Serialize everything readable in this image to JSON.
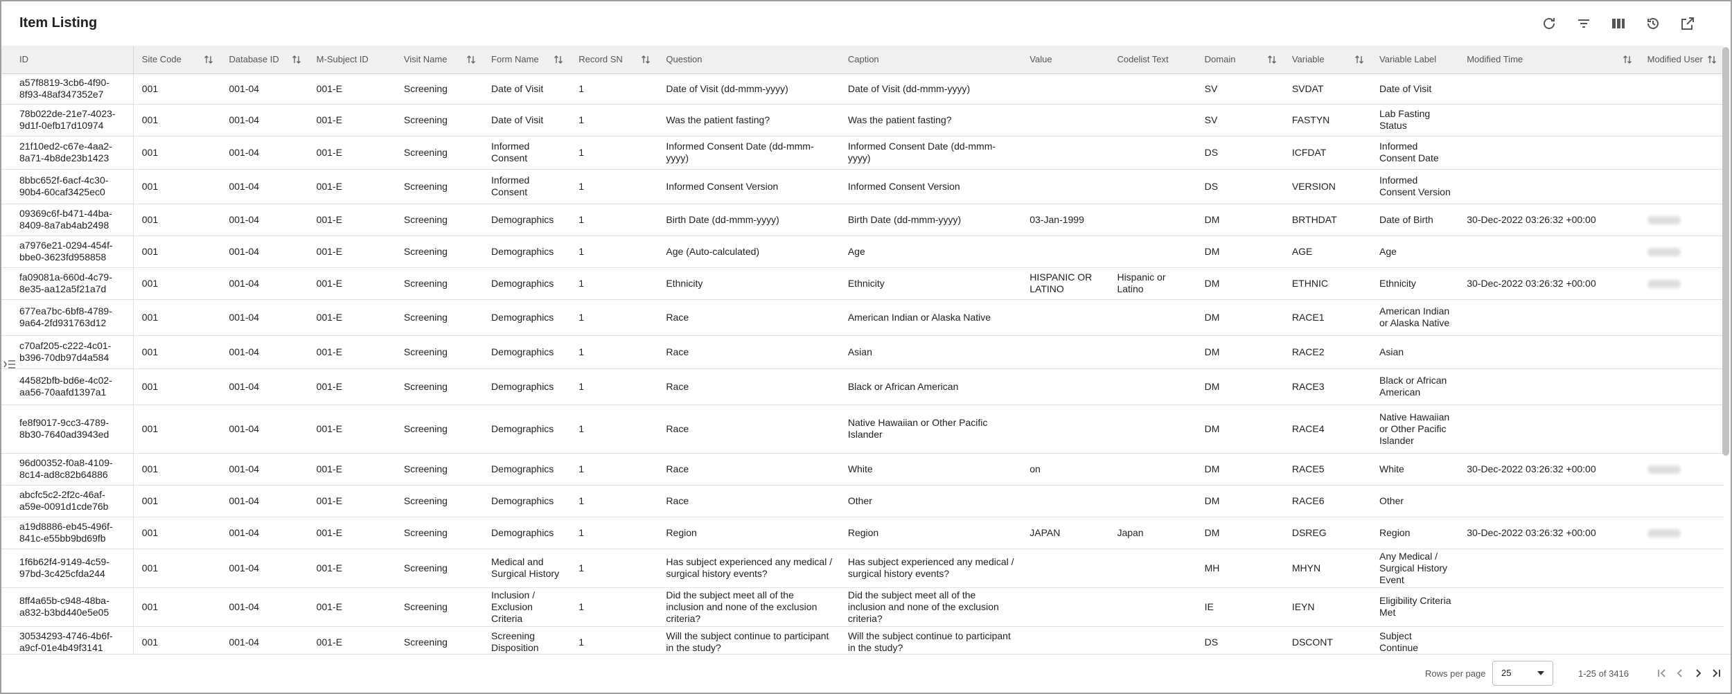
{
  "page": {
    "title": "Item Listing"
  },
  "toolbar": {
    "icons": [
      "refresh-icon",
      "filter-icon",
      "columns-icon",
      "history-icon",
      "open-external-icon"
    ]
  },
  "table": {
    "columns": [
      "ID",
      "Site Code",
      "Database ID",
      "M-Subject ID",
      "Visit Name",
      "Form Name",
      "Record SN",
      "Question",
      "Caption",
      "Value",
      "Codelist Text",
      "Domain",
      "Variable",
      "Variable Label",
      "Modified Time",
      "Modified User"
    ],
    "rows": [
      [
        "a57f8819-3cb6-4f90-8f93-48af347352e7",
        "001",
        "001-04",
        "001-E",
        "Screening",
        "Date of Visit",
        "1",
        "Date of Visit (dd-mmm-yyyy)",
        "Date of Visit (dd-mmm-yyyy)",
        "",
        "",
        "SV",
        "SVDAT",
        "Date of Visit",
        "",
        ""
      ],
      [
        "78b022de-21e7-4023-9d1f-0efb17d10974",
        "001",
        "001-04",
        "001-E",
        "Screening",
        "Date of Visit",
        "1",
        "Was the patient fasting?",
        "Was the patient fasting?",
        "",
        "",
        "SV",
        "FASTYN",
        "Lab Fasting Status",
        "",
        ""
      ],
      [
        "21f10ed2-c67e-4aa2-8a71-4b8de23b1423",
        "001",
        "001-04",
        "001-E",
        "Screening",
        "Informed Consent",
        "1",
        "Informed Consent Date (dd-mmm-yyyy)",
        "Informed Consent Date (dd-mmm-yyyy)",
        "",
        "",
        "DS",
        "ICFDAT",
        "Informed Consent Date",
        "",
        ""
      ],
      [
        "8bbc652f-6acf-4c30-90b4-60caf3425ec0",
        "001",
        "001-04",
        "001-E",
        "Screening",
        "Informed Consent",
        "1",
        "Informed Consent Version",
        "Informed Consent Version",
        "",
        "",
        "DS",
        "VERSION",
        "Informed Consent Version",
        "",
        ""
      ],
      [
        "09369c6f-b471-44ba-8409-8a7ab4ab2498",
        "001",
        "001-04",
        "001-E",
        "Screening",
        "Demographics",
        "1",
        "Birth Date (dd-mmm-yyyy)",
        "Birth Date (dd-mmm-yyyy)",
        "03-Jan-1999",
        "",
        "DM",
        "BRTHDAT",
        "Date of Birth",
        "30-Dec-2022 03:26:32 +00:00",
        "blurred"
      ],
      [
        "a7976e21-0294-454f-bbe0-3623fd958858",
        "001",
        "001-04",
        "001-E",
        "Screening",
        "Demographics",
        "1",
        "Age (Auto-calculated)",
        "Age",
        "",
        "",
        "DM",
        "AGE",
        "Age",
        "",
        "blurred"
      ],
      [
        "fa09081a-660d-4c79-8e35-aa12a5f21a7d",
        "001",
        "001-04",
        "001-E",
        "Screening",
        "Demographics",
        "1",
        "Ethnicity",
        "Ethnicity",
        "HISPANIC OR LATINO",
        "Hispanic or Latino",
        "DM",
        "ETHNIC",
        "Ethnicity",
        "30-Dec-2022 03:26:32 +00:00",
        "blurred"
      ],
      [
        "677ea7bc-6bf8-4789-9a64-2fd931763d12",
        "001",
        "001-04",
        "001-E",
        "Screening",
        "Demographics",
        "1",
        "Race",
        "American Indian or Alaska Native",
        "",
        "",
        "DM",
        "RACE1",
        "American Indian or Alaska Native",
        "",
        ""
      ],
      [
        "c70af205-c222-4c01-b396-70db97d4a584",
        "001",
        "001-04",
        "001-E",
        "Screening",
        "Demographics",
        "1",
        "Race",
        "Asian",
        "",
        "",
        "DM",
        "RACE2",
        "Asian",
        "",
        ""
      ],
      [
        "44582bfb-bd6e-4c02-aa56-70aafd1397a1",
        "001",
        "001-04",
        "001-E",
        "Screening",
        "Demographics",
        "1",
        "Race",
        "Black or African American",
        "",
        "",
        "DM",
        "RACE3",
        "Black or African American",
        "",
        ""
      ],
      [
        "fe8f9017-9cc3-4789-8b30-7640ad3943ed",
        "001",
        "001-04",
        "001-E",
        "Screening",
        "Demographics",
        "1",
        "Race",
        "Native Hawaiian or Other Pacific Islander",
        "",
        "",
        "DM",
        "RACE4",
        "Native Hawaiian or Other Pacific Islander",
        "",
        ""
      ],
      [
        "96d00352-f0a8-4109-8c14-ad8c82b64886",
        "001",
        "001-04",
        "001-E",
        "Screening",
        "Demographics",
        "1",
        "Race",
        "White",
        "on",
        "",
        "DM",
        "RACE5",
        "White",
        "30-Dec-2022 03:26:32 +00:00",
        "blurred"
      ],
      [
        "abcfc5c2-2f2c-46af-a59e-0091d1cde76b",
        "001",
        "001-04",
        "001-E",
        "Screening",
        "Demographics",
        "1",
        "Race",
        "Other",
        "",
        "",
        "DM",
        "RACE6",
        "Other",
        "",
        ""
      ],
      [
        "a19d8886-eb45-496f-841c-e55bb9bd69fb",
        "001",
        "001-04",
        "001-E",
        "Screening",
        "Demographics",
        "1",
        "Region",
        "Region",
        "JAPAN",
        "Japan",
        "DM",
        "DSREG",
        "Region",
        "30-Dec-2022 03:26:32 +00:00",
        "blurred"
      ],
      [
        "1f6b62f4-9149-4c59-97bd-3c425cfda244",
        "001",
        "001-04",
        "001-E",
        "Screening",
        "Medical and Surgical History",
        "1",
        "Has subject experienced any medical / surgical history events?",
        "Has subject experienced any medical / surgical history events?",
        "",
        "",
        "MH",
        "MHYN",
        "Any Medical / Surgical History Event",
        "",
        ""
      ],
      [
        "8ff4a65b-c948-48ba-a832-b3bd440e5e05",
        "001",
        "001-04",
        "001-E",
        "Screening",
        "Inclusion / Exclusion Criteria",
        "1",
        "Did the subject meet all of the inclusion and none of the exclusion criteria?",
        "Did the subject meet all of the inclusion and none of the exclusion criteria?",
        "",
        "",
        "IE",
        "IEYN",
        "Eligibility Criteria Met",
        "",
        ""
      ],
      [
        "30534293-4746-4b6f-a9cf-01e4b49f3141",
        "001",
        "001-04",
        "001-E",
        "Screening",
        "Screening Disposition",
        "1",
        "Will the subject continue to participant in the study?",
        "Will the subject continue to participant in the study?",
        "",
        "",
        "DS",
        "DSCONT",
        "Subject Continue",
        "",
        ""
      ]
    ]
  },
  "footer": {
    "rows_per_page_label": "Rows per page",
    "rows_per_page_value": "25",
    "range_text": "1-25 of 3416"
  }
}
